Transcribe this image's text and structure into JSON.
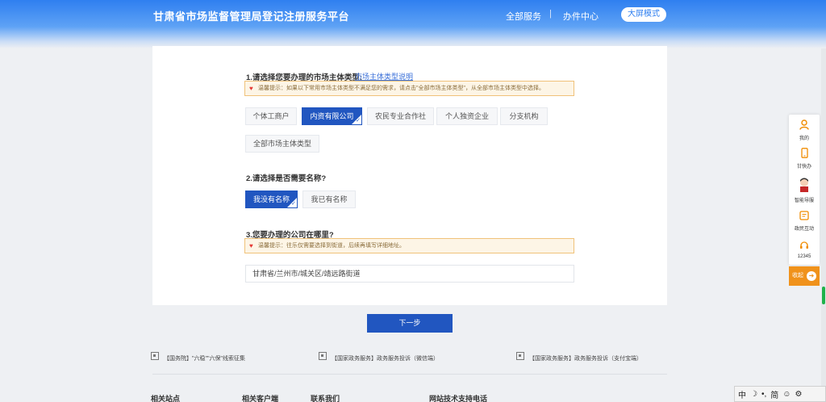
{
  "header": {
    "title": "甘肃省市场监督管理局登记注册服务平台",
    "nav": [
      "全部服务",
      "办件中心"
    ],
    "separator": "|",
    "big_mode_label": "大屏模式"
  },
  "section1": {
    "title": "1.请选择您要办理的市场主体类型:",
    "link": "市场主体类型说明",
    "tip": "温馨提示：如果以下常用市场主体类型不满足您的需求，请点击\"全部市场主体类型\"，从全部市场主体类型中选择。",
    "options": [
      "个体工商户",
      "内资有限公司",
      "农民专业合作社",
      "个人独资企业",
      "分支机构",
      "全部市场主体类型"
    ],
    "selected": "内资有限公司"
  },
  "section2": {
    "title": "2.请选择是否需要名称?",
    "options": [
      "我没有名称",
      "我已有名称"
    ],
    "selected": "我没有名称"
  },
  "section3": {
    "title": "3.您要办理的公司在哪里?",
    "tip": "温馨提示：往乐仅需要选择到街道，后续再填写详细地址。",
    "address_value": "甘肃省/兰州市/城关区/靖远路街道"
  },
  "next_button": "下一步",
  "footer": {
    "links": [
      "【国务院】\"六稳\"\"六保\"线索征集",
      "【国家政务服务】政务服务投诉（微信端）",
      "【国家政务服务】政务服务投诉（支付宝端）"
    ],
    "headings": [
      "相关站点",
      "相关客户端",
      "联系我们",
      "网站技术支持电话"
    ]
  },
  "side_panel": {
    "items": [
      {
        "label": "我的",
        "icon": "user-icon"
      },
      {
        "label": "甘快办",
        "icon": "phone-icon"
      },
      {
        "label": "智能导服",
        "icon": "assistant-avatar-icon"
      },
      {
        "label": "政民互动",
        "icon": "message-icon"
      },
      {
        "label": "12345",
        "icon": "headset-icon"
      }
    ],
    "collect_label": "收起"
  },
  "ime": {
    "items": [
      "中",
      "•,",
      "简"
    ]
  },
  "colors": {
    "primary": "#2156c0",
    "header": "#2f7ff0",
    "accent": "#f0921b",
    "tip_bg": "#fdf5e6"
  }
}
